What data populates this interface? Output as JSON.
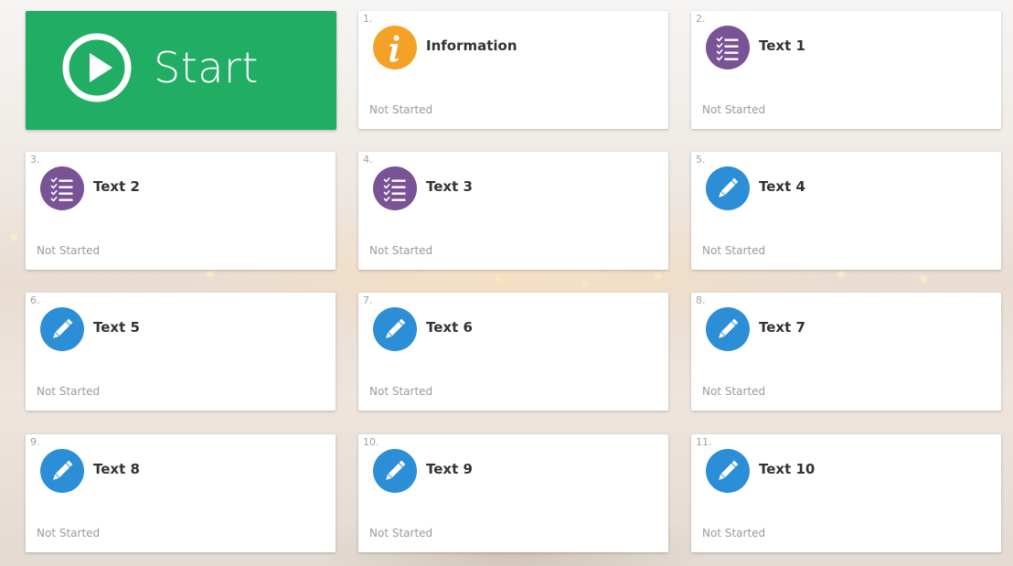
{
  "start": {
    "label": "Start"
  },
  "colors": {
    "start_green": "#22ad64",
    "info_orange": "#f4a227",
    "list_purple": "#7a5296",
    "edit_blue": "#2c8ed6"
  },
  "tiles": [
    {
      "number": "1.",
      "title": "Information",
      "status": "Not Started",
      "icon": "info-icon"
    },
    {
      "number": "2.",
      "title": "Text 1",
      "status": "Not Started",
      "icon": "checklist-icon"
    },
    {
      "number": "3.",
      "title": "Text 2",
      "status": "Not Started",
      "icon": "checklist-icon"
    },
    {
      "number": "4.",
      "title": "Text 3",
      "status": "Not Started",
      "icon": "checklist-icon"
    },
    {
      "number": "5.",
      "title": "Text 4",
      "status": "Not Started",
      "icon": "pencil-icon"
    },
    {
      "number": "6.",
      "title": "Text 5",
      "status": "Not Started",
      "icon": "pencil-icon"
    },
    {
      "number": "7.",
      "title": "Text 6",
      "status": "Not Started",
      "icon": "pencil-icon"
    },
    {
      "number": "8.",
      "title": "Text 7",
      "status": "Not Started",
      "icon": "pencil-icon"
    },
    {
      "number": "9.",
      "title": "Text 8",
      "status": "Not Started",
      "icon": "pencil-icon"
    },
    {
      "number": "10.",
      "title": "Text 9",
      "status": "Not Started",
      "icon": "pencil-icon"
    },
    {
      "number": "11.",
      "title": "Text 10",
      "status": "Not Started",
      "icon": "pencil-icon"
    }
  ]
}
